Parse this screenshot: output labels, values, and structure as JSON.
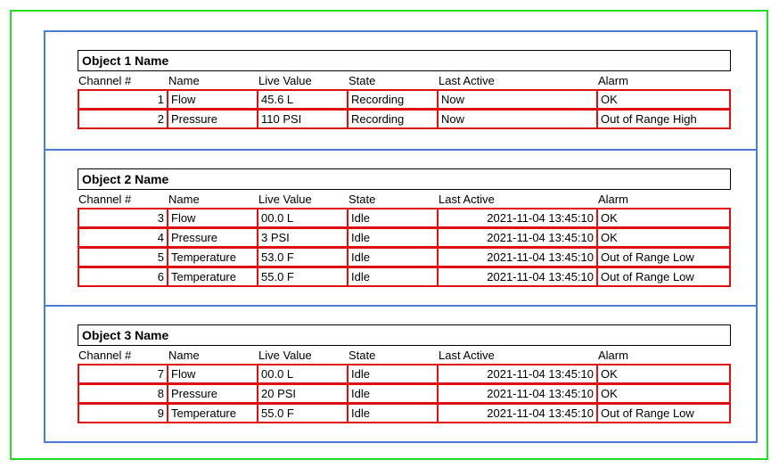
{
  "columns": [
    "Channel #",
    "Name",
    "Live Value",
    "State",
    "Last Active",
    "Alarm"
  ],
  "objects": [
    {
      "title": "Object 1 Name",
      "rows": [
        [
          "1",
          "Flow",
          "45.6 L",
          "Recording",
          "Now",
          "OK"
        ],
        [
          "2",
          "Pressure",
          "110 PSI",
          "Recording",
          "Now",
          "Out of Range High"
        ]
      ]
    },
    {
      "title": "Object 2 Name",
      "rows": [
        [
          "3",
          "Flow",
          "00.0 L",
          "Idle",
          "2021-11-04 13:45:10",
          "OK"
        ],
        [
          "4",
          "Pressure",
          "3 PSI",
          "Idle",
          "2021-11-04 13:45:10",
          "OK"
        ],
        [
          "5",
          "Temperature",
          "53.0 F",
          "Idle",
          "2021-11-04 13:45:10",
          "Out of Range Low"
        ],
        [
          "6",
          "Temperature",
          "55.0 F",
          "Idle",
          "2021-11-04 13:45:10",
          "Out of Range Low"
        ]
      ]
    },
    {
      "title": "Object 3 Name",
      "rows": [
        [
          "7",
          "Flow",
          "00.0 L",
          "Idle",
          "2021-11-04 13:45:10",
          "OK"
        ],
        [
          "8",
          "Pressure",
          "20 PSI",
          "Idle",
          "2021-11-04 13:45:10",
          "OK"
        ],
        [
          "9",
          "Temperature",
          "55.0 F",
          "Idle",
          "2021-11-04 13:45:10",
          "Out of Range Low"
        ]
      ]
    }
  ],
  "colors": {
    "outer_border": "#22dd22",
    "inner_border": "#4a7fcf",
    "row_border": "#e01010"
  }
}
